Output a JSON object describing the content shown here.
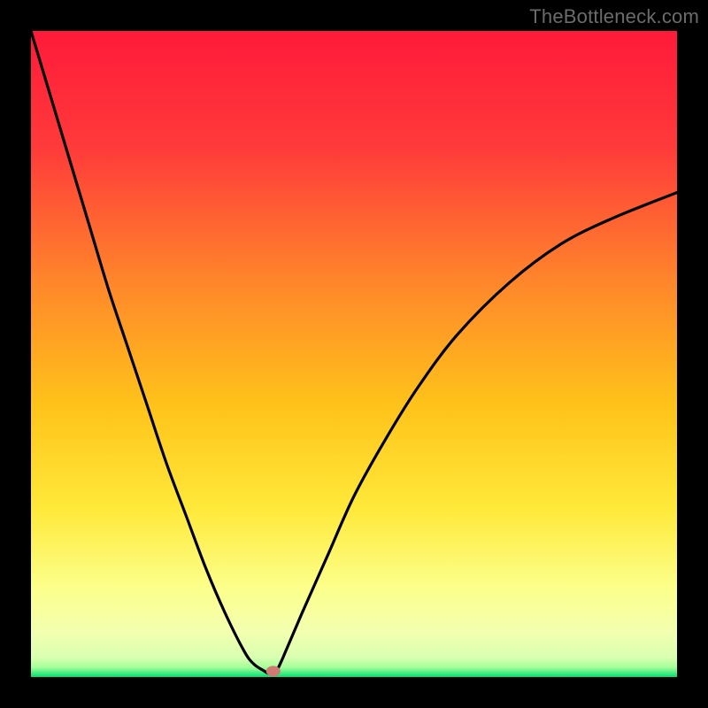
{
  "watermark": "TheBottleneck.com",
  "chart_data": {
    "type": "line",
    "title": "",
    "xlabel": "",
    "ylabel": "",
    "xlim": [
      0,
      100
    ],
    "ylim": [
      0,
      100
    ],
    "grid": false,
    "legend": false,
    "background_gradient": {
      "top": "#ff1a3a",
      "mid_upper": "#ff8a2a",
      "mid": "#ffd400",
      "mid_lower": "#fff68a",
      "lower": "#f6ffb0",
      "bottom": "#00e070"
    },
    "series": [
      {
        "name": "bottleneck-curve",
        "x": [
          0,
          3,
          6,
          9,
          12,
          15,
          18,
          21,
          24,
          27,
          30,
          33,
          34.5,
          36,
          37,
          38,
          39,
          42,
          46,
          50,
          55,
          60,
          66,
          74,
          82,
          90,
          100
        ],
        "y": [
          100,
          90,
          80,
          70,
          60,
          51,
          42,
          33,
          25,
          17,
          10,
          4,
          2,
          1,
          0.5,
          1,
          3,
          10,
          19,
          28,
          37,
          45,
          53,
          61,
          67,
          71,
          75
        ]
      }
    ],
    "markers": [
      {
        "name": "valley-marker",
        "x": 37.5,
        "y": 0.9,
        "color": "#cf7a73",
        "rx": 8,
        "ry": 6
      }
    ]
  }
}
